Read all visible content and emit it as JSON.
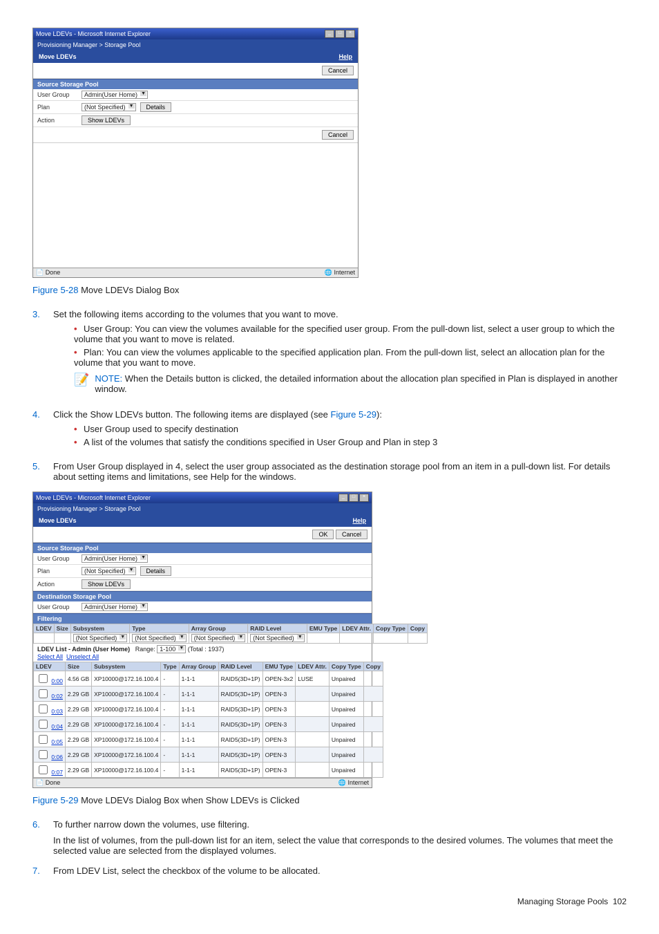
{
  "fig1": {
    "win_title": "Move LDEVs - Microsoft Internet Explorer",
    "breadcrumb": "Provisioning Manager > Storage Pool",
    "page_title": "Move LDEVs",
    "help": "Help",
    "cancel": "Cancel",
    "src_header": "Source Storage Pool",
    "user_group_lbl": "User Group",
    "user_group_val": "Admin(User Home)",
    "plan_lbl": "Plan",
    "plan_val": "(Not Specified)",
    "details_btn": "Details",
    "action_lbl": "Action",
    "show_btn": "Show LDEVs",
    "status_done": "Done",
    "status_zone": "Internet"
  },
  "cap1": {
    "link": "Figure 5-28",
    "text": " Move LDEVs Dialog Box"
  },
  "step3": {
    "num": "3.",
    "lead": "Set the following items according to the volumes that you want to move.",
    "b1": "User Group: You can view the volumes available for the specified user group. From the pull-down list, select a user group to which the volume that you want to move is related.",
    "b2": "Plan: You can view the volumes applicable to the specified application plan. From the pull-down list, select an allocation plan for the volume that you want to move."
  },
  "note": {
    "label": "NOTE:  ",
    "text": "When the Details button is clicked, the detailed information about the allocation plan specified in Plan is displayed in another window."
  },
  "step4": {
    "num": "4.",
    "lead_a": "Click the Show LDEVs button. The following items are displayed (see ",
    "lead_link": "Figure 5-29",
    "lead_b": "):",
    "b1": "User Group used to specify destination",
    "b2": "A list of the volumes that satisfy the conditions specified in User Group and Plan in step 3"
  },
  "step5": {
    "num": "5.",
    "text": "From User Group displayed in 4, select the user group associated as the destination storage pool from an item in a pull-down list. For details about setting items and limitations, see Help for the windows."
  },
  "fig2": {
    "ok": "OK",
    "dest_header": "Destination Storage Pool",
    "filtering": "Filtering",
    "not_spec": "(Not Specified)",
    "list_title": "LDEV List - Admin (User Home)",
    "range_lbl": "Range:",
    "range_val": "1-100",
    "total": "(Total : 1937)",
    "select_all": "Select All",
    "unselect_all": "Unselect All",
    "headers": [
      "LDEV",
      "Size",
      "Subsystem",
      "Type",
      "Array Group",
      "RAID Level",
      "EMU Type",
      "LDEV Attr.",
      "Copy Type",
      "Copy"
    ],
    "rows": [
      {
        "ldev": "0:00",
        "size": "4.56 GB",
        "sub": "XP10000@172.16.100.4",
        "type": "-",
        "ag": "1-1-1",
        "raid": "RAID5(3D+1P)",
        "emu": "OPEN-3x2",
        "attr": "LUSE",
        "ct": "Unpaired"
      },
      {
        "ldev": "0:02",
        "size": "2.29 GB",
        "sub": "XP10000@172.16.100.4",
        "type": "-",
        "ag": "1-1-1",
        "raid": "RAID5(3D+1P)",
        "emu": "OPEN-3",
        "attr": "",
        "ct": "Unpaired"
      },
      {
        "ldev": "0:03",
        "size": "2.29 GB",
        "sub": "XP10000@172.16.100.4",
        "type": "-",
        "ag": "1-1-1",
        "raid": "RAID5(3D+1P)",
        "emu": "OPEN-3",
        "attr": "",
        "ct": "Unpaired"
      },
      {
        "ldev": "0:04",
        "size": "2.29 GB",
        "sub": "XP10000@172.16.100.4",
        "type": "-",
        "ag": "1-1-1",
        "raid": "RAID5(3D+1P)",
        "emu": "OPEN-3",
        "attr": "",
        "ct": "Unpaired"
      },
      {
        "ldev": "0:05",
        "size": "2.29 GB",
        "sub": "XP10000@172.16.100.4",
        "type": "-",
        "ag": "1-1-1",
        "raid": "RAID5(3D+1P)",
        "emu": "OPEN-3",
        "attr": "",
        "ct": "Unpaired"
      },
      {
        "ldev": "0:06",
        "size": "2.29 GB",
        "sub": "XP10000@172.16.100.4",
        "type": "-",
        "ag": "1-1-1",
        "raid": "RAID5(3D+1P)",
        "emu": "OPEN-3",
        "attr": "",
        "ct": "Unpaired"
      },
      {
        "ldev": "0:07",
        "size": "2.29 GB",
        "sub": "XP10000@172.16.100.4",
        "type": "-",
        "ag": "1-1-1",
        "raid": "RAID5(3D+1P)",
        "emu": "OPEN-3",
        "attr": "",
        "ct": "Unpaired"
      }
    ]
  },
  "cap2": {
    "link": "Figure 5-29",
    "text": " Move LDEVs Dialog Box when Show LDEVs is Clicked"
  },
  "step6": {
    "num": "6.",
    "lead": "To further narrow down the volumes, use filtering.",
    "body": "In the list of volumes, from the pull-down list for an item, select the value that corresponds to the desired volumes. The volumes that meet the selected value are selected from the displayed volumes."
  },
  "step7": {
    "num": "7.",
    "text": "From LDEV List, select the checkbox of the volume to be allocated."
  },
  "footer": {
    "text": "Managing Storage Pools",
    "page": "102"
  }
}
